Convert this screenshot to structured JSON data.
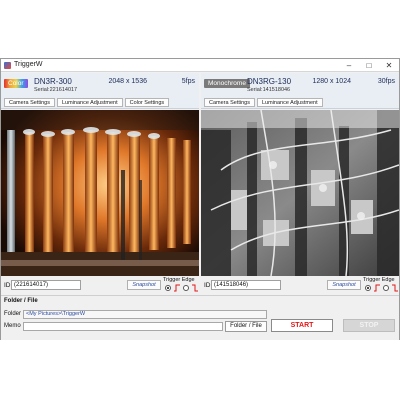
{
  "window": {
    "title": "TriggerW"
  },
  "cameras": [
    {
      "badge": "Color",
      "model": "DN3R-300",
      "serial": "Serial:221614017",
      "resolution": "2048 x 1536",
      "fps": "5fps",
      "tabs": [
        "Camera Settings",
        "Luminance Adjustment",
        "Color Settings"
      ],
      "id_label": "ID",
      "id_value": "(221614017)",
      "snapshot_label": "Snapshot",
      "trigger_label": "Trigger Edge"
    },
    {
      "badge": "Monochrome",
      "model": "DN3RG-130",
      "serial": "Serial:141518046",
      "resolution": "1280 x 1024",
      "fps": "30fps",
      "tabs": [
        "Camera Settings",
        "Luminance Adjustment"
      ],
      "id_label": "ID",
      "id_value": "(141518046)",
      "snapshot_label": "Snapshot",
      "trigger_label": "Trigger Edge"
    }
  ],
  "bottom": {
    "section_title": "Folder / File",
    "folder_label": "Folder",
    "folder_value": "<My Pictures>\\TriggerW",
    "memo_label": "Memo",
    "memo_value": "",
    "folder_button": "Folder / File",
    "start_button": "START",
    "stop_button": "STOP"
  },
  "colors": {
    "start_text": "#e01818",
    "edge_arrow": "#e01818"
  }
}
